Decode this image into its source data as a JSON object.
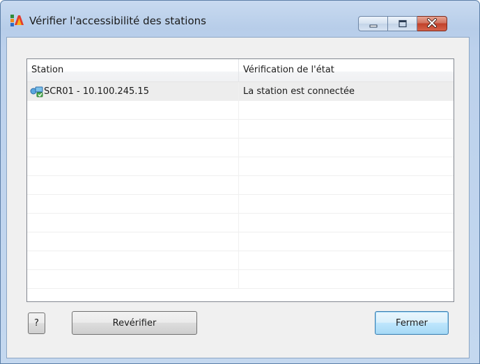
{
  "window": {
    "title": "Vérifier l'accessibilité des stations",
    "app_icon": "avg-logo-icon",
    "controls": {
      "minimize_icon": "minimize-icon",
      "maximize_icon": "maximize-icon",
      "close_icon": "close-icon"
    }
  },
  "list": {
    "columns": [
      "Station",
      "Vérification de l'état"
    ],
    "rows": [
      {
        "icon": "network-station-icon",
        "station": "SCR01 - 10.100.245.15",
        "status": "La station est connectée",
        "selected": true
      }
    ],
    "empty_rows": 10
  },
  "buttons": {
    "help": "?",
    "recheck": "Revérifier",
    "close": "Fermer"
  },
  "colors": {
    "close_button": "#c1412a",
    "default_button": "#a7d9f5",
    "selected_row": "#ededed"
  }
}
